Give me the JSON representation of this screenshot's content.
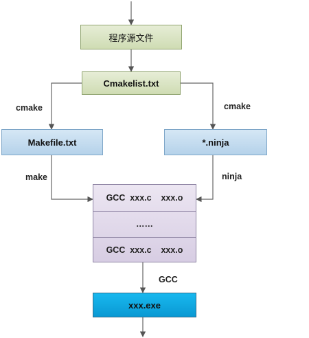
{
  "nodes": {
    "source_files": "程序源文件",
    "cmakelist": "Cmakelist.txt",
    "makefile": "Makefile.txt",
    "ninja_file": "*.ninja",
    "gcc_row1": "GCC  xxx.c    xxx.o",
    "gcc_ellipsis": "……",
    "gcc_row3": "GCC  xxx.c    xxx.o",
    "exe": "xxx.exe"
  },
  "edge_labels": {
    "cmake_left": "cmake",
    "cmake_right": "cmake",
    "make": "make",
    "ninja": "ninja",
    "gcc": "GCC"
  },
  "colors": {
    "green": "#d9e4c3",
    "blue": "#c5dcef",
    "purple": "#e2daeb",
    "cyan": "#12aae3",
    "arrow": "#666666"
  }
}
